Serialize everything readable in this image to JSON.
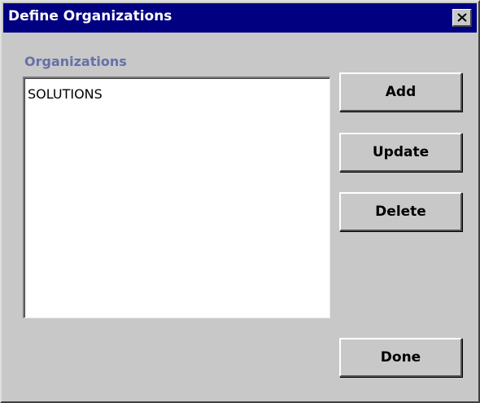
{
  "window": {
    "title": "Define Organizations",
    "close_icon": "close-icon"
  },
  "organizations": {
    "label": "Organizations",
    "items": [
      "SOLUTIONS"
    ]
  },
  "buttons": {
    "add": "Add",
    "update": "Update",
    "delete": "Delete",
    "done": "Done"
  },
  "colors": {
    "titlebar": "#000080",
    "label_text": "#6670a8",
    "face": "#c8c8c8"
  }
}
